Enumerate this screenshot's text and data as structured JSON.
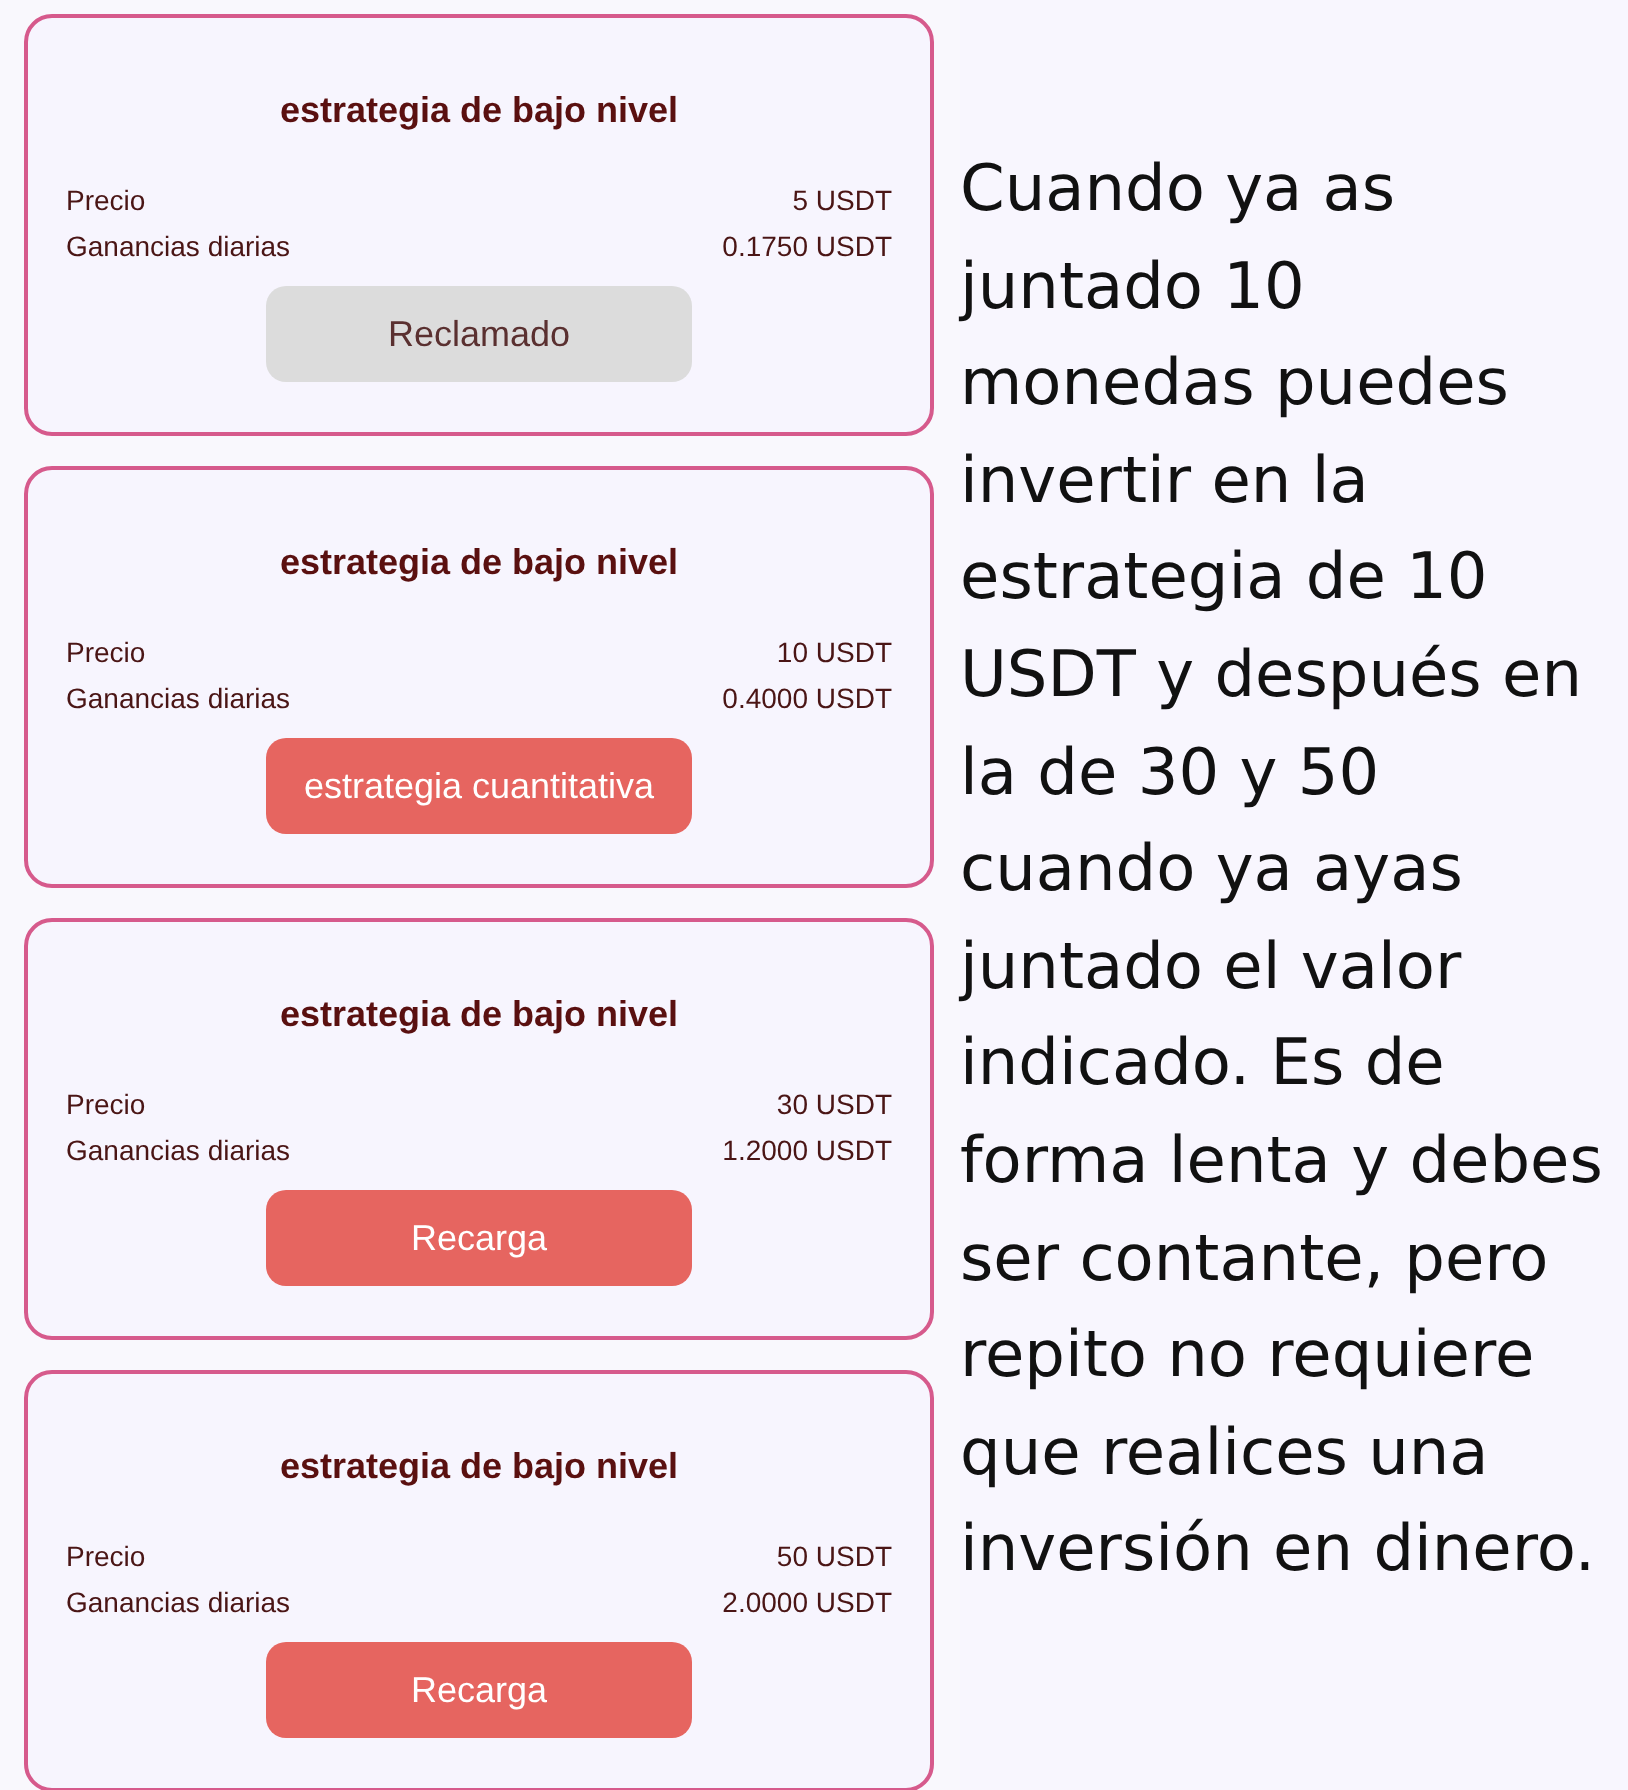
{
  "plans": [
    {
      "title": "estrategia de bajo nivel",
      "price_label": "Precio",
      "price": "5 USDT",
      "earnings_label": "Ganancias diarias",
      "earnings": "0.1750 USDT",
      "button": {
        "label": "Reclamado",
        "disabled": true
      }
    },
    {
      "title": "estrategia de bajo nivel",
      "price_label": "Precio",
      "price": "10 USDT",
      "earnings_label": "Ganancias diarias",
      "earnings": "0.4000 USDT",
      "button": {
        "label": "estrategia cuantitativa",
        "disabled": false
      }
    },
    {
      "title": "estrategia de bajo nivel",
      "price_label": "Precio",
      "price": "30 USDT",
      "earnings_label": "Ganancias diarias",
      "earnings": "1.2000 USDT",
      "button": {
        "label": "Recarga",
        "disabled": false
      }
    },
    {
      "title": "estrategia de bajo nivel",
      "price_label": "Precio",
      "price": "50 USDT",
      "earnings_label": "Ganancias diarias",
      "earnings": "2.0000 USDT",
      "button": {
        "label": "Recarga",
        "disabled": false
      }
    }
  ],
  "note": "Cuando ya as juntado 10 monedas puedes invertir en la estrategia de 10 USDT y después en la de 30 y 50 cuando ya ayas juntado el valor indicado. Es de forma lenta y debes ser contante, pero repito no requiere que realices una inversión en dinero."
}
